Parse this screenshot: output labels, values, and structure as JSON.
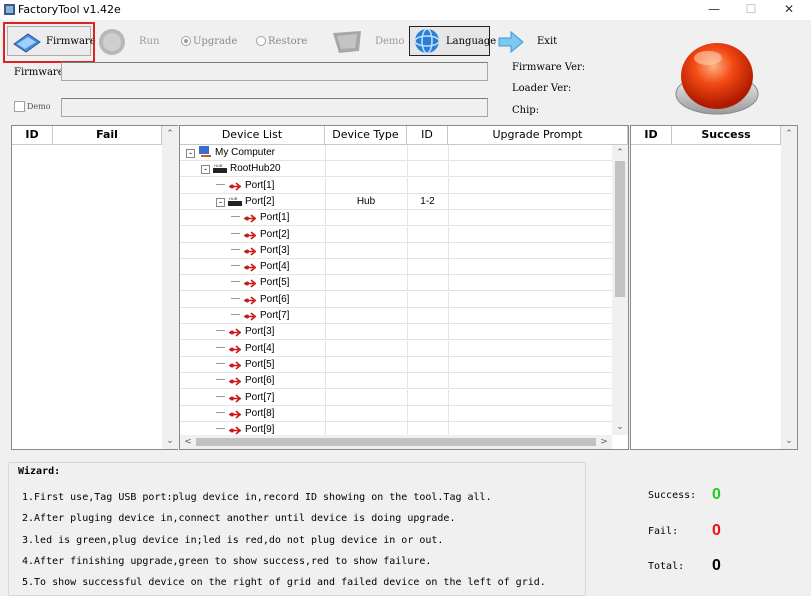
{
  "window": {
    "title": "FactoryTool v1.42e",
    "minimize": "—",
    "maximize": "☐",
    "close": "✕"
  },
  "toolbar": {
    "firmware": "Firmware",
    "run": "Run",
    "upgrade": "Upgrade",
    "restore": "Restore",
    "demo": "Demo",
    "language": "Language",
    "exit": "Exit"
  },
  "info": {
    "firmware_label": "Firmware",
    "firmware_path": "",
    "demo_label": "Demo",
    "demo_value": "",
    "firmware_ver_label": "Firmware Ver:",
    "loader_ver_label": "Loader Ver:",
    "chip_label": "Chip:"
  },
  "fail_grid": {
    "col_id": "ID",
    "col_fail": "Fail"
  },
  "success_grid": {
    "col_id": "ID",
    "col_success": "Success"
  },
  "device_grid": {
    "columns": [
      "Device List",
      "Device Type",
      "ID",
      "Upgrade Prompt"
    ],
    "rows": [
      {
        "label": "My Computer",
        "type": "",
        "id": ""
      },
      {
        "label": "RootHub20",
        "type": "",
        "id": ""
      },
      {
        "label": "Port[1]",
        "type": "",
        "id": ""
      },
      {
        "label": "Port[2]",
        "type": "Hub",
        "id": "1-2"
      },
      {
        "label": "Port[1]",
        "type": "",
        "id": ""
      },
      {
        "label": "Port[2]",
        "type": "",
        "id": ""
      },
      {
        "label": "Port[3]",
        "type": "",
        "id": ""
      },
      {
        "label": "Port[4]",
        "type": "",
        "id": ""
      },
      {
        "label": "Port[5]",
        "type": "",
        "id": ""
      },
      {
        "label": "Port[6]",
        "type": "",
        "id": ""
      },
      {
        "label": "Port[7]",
        "type": "",
        "id": ""
      },
      {
        "label": "Port[3]",
        "type": "",
        "id": ""
      },
      {
        "label": "Port[4]",
        "type": "",
        "id": ""
      },
      {
        "label": "Port[5]",
        "type": "",
        "id": ""
      },
      {
        "label": "Port[6]",
        "type": "",
        "id": ""
      },
      {
        "label": "Port[7]",
        "type": "",
        "id": ""
      },
      {
        "label": "Port[8]",
        "type": "",
        "id": ""
      },
      {
        "label": "Port[9]",
        "type": "",
        "id": ""
      }
    ]
  },
  "wizard": {
    "title": "Wizard:",
    "lines": [
      "1.First use,Tag USB port:plug device in,record ID showing on the tool.Tag all.",
      "2.After pluging device in,connect another until device is doing upgrade.",
      "3.led is green,plug device in;led is red,do not plug device in or out.",
      "4.After finishing upgrade,green to show success,red to show failure.",
      "5.To show successful device on the right of grid and failed device on the left of grid."
    ]
  },
  "stats": {
    "success_label": "Success:",
    "success_value": "0",
    "fail_label": "Fail:",
    "fail_value": "0",
    "total_label": "Total:",
    "total_value": "0",
    "colors": {
      "success": "#22cc22",
      "fail": "#ee1111",
      "total": "#000000"
    }
  },
  "icons": [
    "app-icon",
    "firmware-icon",
    "run-icon",
    "demo-icon",
    "language-globe-icon",
    "exit-arrow-icon",
    "status-lamp-icon",
    "computer-icon",
    "hub-icon",
    "usb-port-icon"
  ]
}
